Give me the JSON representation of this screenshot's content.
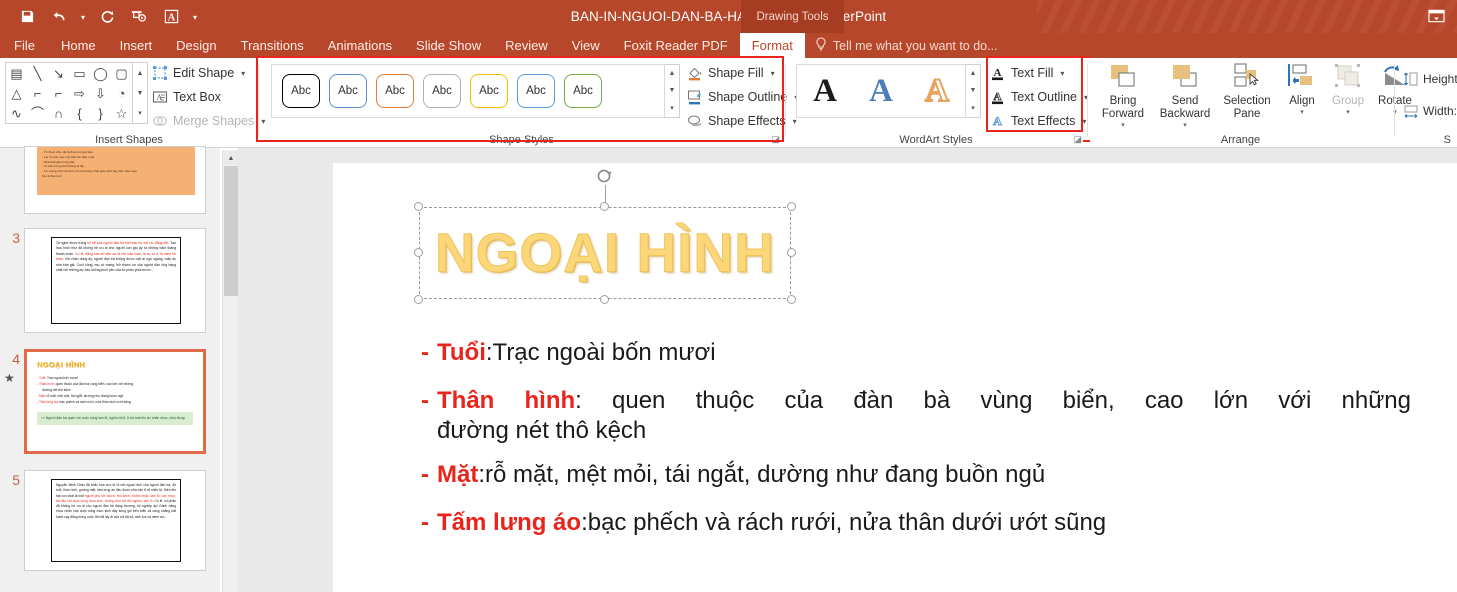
{
  "titlebar": {
    "document_title": "BAN-IN-NGUOI-DAN-BA-HANG-CHAI - PowerPoint",
    "contextual_tools": "Drawing Tools",
    "quick_access": [
      {
        "name": "save-icon",
        "label": "Save"
      },
      {
        "name": "undo-icon",
        "label": "Undo"
      },
      {
        "name": "redo-icon",
        "label": "Redo"
      },
      {
        "name": "start-slideshow-icon",
        "label": "Start From Beginning"
      },
      {
        "name": "wordart-icon",
        "label": "WordArt"
      },
      {
        "name": "customize-qat-icon",
        "label": "Customize Quick Access Toolbar"
      }
    ],
    "ribbon_display_options": "Ribbon Display Options",
    "accent_color": "#b7472a"
  },
  "tabs": [
    {
      "label": "File",
      "active": false
    },
    {
      "label": "Home",
      "active": false
    },
    {
      "label": "Insert",
      "active": false
    },
    {
      "label": "Design",
      "active": false
    },
    {
      "label": "Transitions",
      "active": false
    },
    {
      "label": "Animations",
      "active": false
    },
    {
      "label": "Slide Show",
      "active": false
    },
    {
      "label": "Review",
      "active": false
    },
    {
      "label": "View",
      "active": false
    },
    {
      "label": "Foxit Reader PDF",
      "active": false
    },
    {
      "label": "Format",
      "active": true
    }
  ],
  "tell_me": {
    "placeholder": "Tell me what you want to do...",
    "icon": "lightbulb-icon"
  },
  "ribbon": {
    "insert_shapes": {
      "group_label": "Insert Shapes",
      "shape_glyphs": [
        "▤",
        "＼",
        "↘",
        "▭",
        "◯",
        "▢",
        "△",
        "⌐",
        "⌐",
        "⇨",
        "⇩",
        "◔",
        "∿",
        "⌒",
        "∩",
        "{",
        "}",
        "☆"
      ],
      "commands": [
        {
          "label": "Edit Shape",
          "icon": "edit-shape-icon",
          "has_caret": true,
          "disabled": false
        },
        {
          "label": "Text Box",
          "icon": "text-box-icon",
          "has_caret": false,
          "disabled": false
        },
        {
          "label": "Merge Shapes",
          "icon": "merge-shapes-icon",
          "has_caret": true,
          "disabled": true
        }
      ]
    },
    "shape_styles": {
      "group_label": "Shape Styles",
      "highlighted": true,
      "thumbnails": [
        {
          "text": "Abc",
          "outline": "#000000"
        },
        {
          "text": "Abc",
          "outline": "#5b8fc9"
        },
        {
          "text": "Abc",
          "outline": "#e07b39"
        },
        {
          "text": "Abc",
          "outline": "#b0b0b0"
        },
        {
          "text": "Abc",
          "outline": "#f0c000"
        },
        {
          "text": "Abc",
          "outline": "#5b9bd5"
        },
        {
          "text": "Abc",
          "outline": "#70ad47"
        }
      ],
      "commands": [
        {
          "label": "Shape Fill",
          "icon": "shape-fill-icon",
          "has_caret": true
        },
        {
          "label": "Shape Outline",
          "icon": "shape-outline-icon",
          "has_caret": true
        },
        {
          "label": "Shape Effects",
          "icon": "shape-effects-icon",
          "has_caret": true
        }
      ]
    },
    "wordart_styles": {
      "group_label": "WordArt Styles",
      "thumbnails": [
        {
          "glyph": "A",
          "color": "#1a1a1a"
        },
        {
          "glyph": "A",
          "color": "#4a7ebb"
        },
        {
          "glyph": "A",
          "color": "#e8a35c"
        }
      ],
      "highlighted": true,
      "commands": [
        {
          "label": "Text Fill",
          "icon": "text-fill-icon",
          "has_caret": true
        },
        {
          "label": "Text Outline",
          "icon": "text-outline-icon",
          "has_caret": true
        },
        {
          "label": "Text Effects",
          "icon": "text-effects-icon",
          "has_caret": true
        }
      ]
    },
    "arrange": {
      "group_label": "Arrange",
      "buttons": [
        {
          "line1": "Bring",
          "line2": "Forward",
          "icon": "bring-forward-icon",
          "has_caret": true,
          "disabled": false
        },
        {
          "line1": "Send",
          "line2": "Backward",
          "icon": "send-backward-icon",
          "has_caret": true,
          "disabled": false
        },
        {
          "line1": "Selection",
          "line2": "Pane",
          "icon": "selection-pane-icon",
          "has_caret": false,
          "disabled": false
        },
        {
          "line1": "Align",
          "line2": "",
          "icon": "align-icon",
          "has_caret": true,
          "disabled": false
        },
        {
          "line1": "Group",
          "line2": "",
          "icon": "group-icon",
          "has_caret": true,
          "disabled": true
        },
        {
          "line1": "Rotate",
          "line2": "",
          "icon": "rotate-icon",
          "has_caret": true,
          "disabled": false
        }
      ]
    },
    "size": {
      "group_label": "S",
      "rows": [
        {
          "label": "Height",
          "icon": "height-icon"
        },
        {
          "label": "Width:",
          "icon": "width-icon"
        }
      ]
    }
  },
  "slide_pane": {
    "slides": [
      {
        "number": "",
        "selected": false,
        "has_star": false
      },
      {
        "number": "3",
        "selected": false,
        "has_star": false
      },
      {
        "number": "4",
        "selected": true,
        "has_star": true
      },
      {
        "number": "5",
        "selected": false,
        "has_star": false
      }
    ],
    "thumb4": {
      "title": "NGOẠI HÌNH",
      "bullets": [
        "Tuổi: Trạc ngoài bốn mươi",
        "Thân hình: quen thuộc của đàn bà vùng biển, cao lớn với những đường nét thô kệch",
        "Mặt: rỗ mặt, mệt mỏi, tái ngắt, dường như đang buồn ngủ",
        "Tấm lưng áo: bạc phếch và rách rưới, nửa thân dưới ướt sũng"
      ],
      "conclusion": "=> Người đàn bà quen với cuộc sống lam lũ, nghèo khổ, ở bà toát lên sự nhẫn nhục, chịu đựng"
    }
  },
  "slide": {
    "wordart_title": "NGOẠI HÌNH",
    "wordart_color": "#fbd77a",
    "label_color": "#e8241b",
    "bullets": [
      {
        "dash": "-",
        "label": "Tuổi",
        "sep": ": ",
        "text": "Trạc ngoài bốn mươi",
        "justify": false
      },
      {
        "dash": "-",
        "label": "Thân hình",
        "sep": ": ",
        "text": "quen thuộc của đàn bà vùng biển, cao lớn với những",
        "text2": "đường nét thô kệch",
        "justify": true
      },
      {
        "dash": "-",
        "label": "Mặt",
        "sep": ": ",
        "text": "rỗ mặt, mệt mỏi, tái ngắt, dường như đang buồn ngủ",
        "justify": false
      },
      {
        "dash": "-",
        "label": "Tấm lưng áo",
        "sep": ": ",
        "text": "bạc phếch và rách rưới, nửa thân dưới ướt sũng",
        "justify": false
      }
    ]
  }
}
